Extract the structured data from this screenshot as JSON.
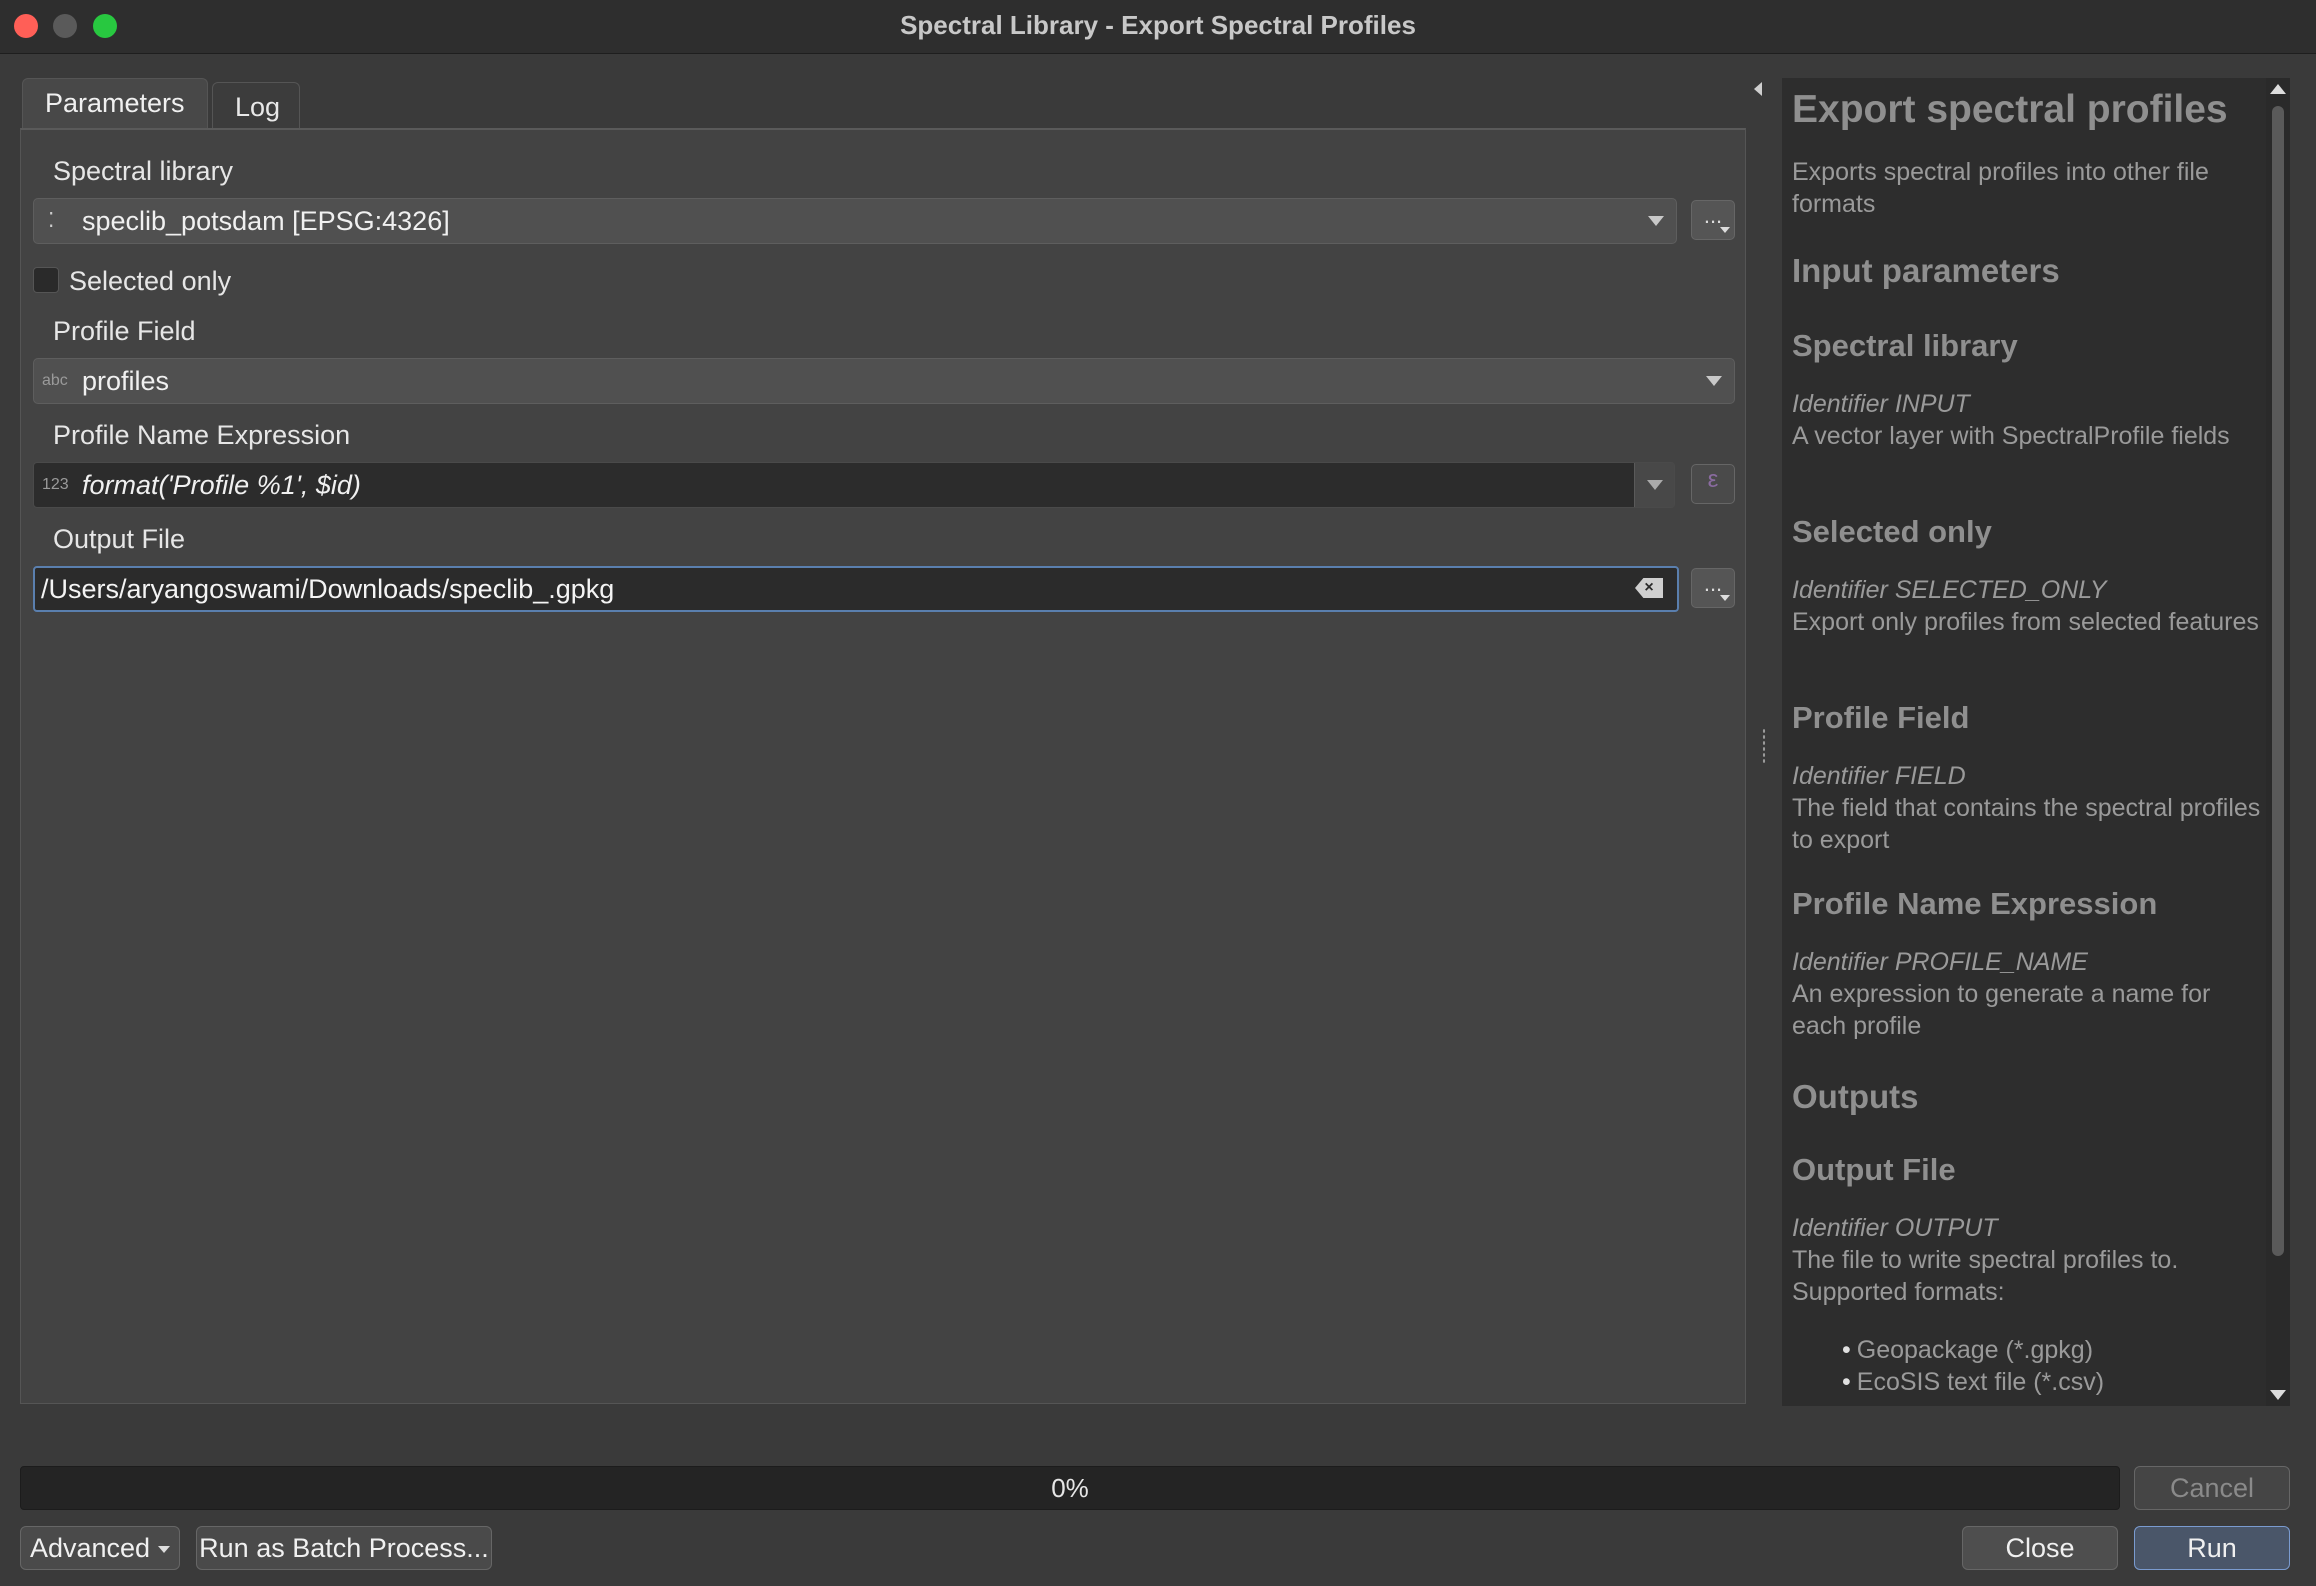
{
  "window": {
    "title": "Spectral Library - Export Spectral Profiles"
  },
  "tabs": [
    {
      "label": "Parameters",
      "active": true
    },
    {
      "label": "Log",
      "active": false
    }
  ],
  "form": {
    "spectral_library": {
      "label": "Spectral library",
      "value": "speclib_potsdam [EPSG:4326]",
      "browse": "..."
    },
    "selected_only": {
      "label": "Selected only",
      "checked": false
    },
    "profile_field": {
      "label": "Profile Field",
      "type_tag": "abc",
      "value": "profiles"
    },
    "profile_name": {
      "label": "Profile Name Expression",
      "type_tag": "123",
      "value": "format('Profile %1', $id)"
    },
    "output_file": {
      "label": "Output File",
      "value": "/Users/aryangoswami/Downloads/speclib_.gpkg",
      "browse": "..."
    }
  },
  "help": {
    "title": "Export spectral profiles",
    "description": "Exports spectral profiles into other file formats",
    "input_header": "Input parameters",
    "params": [
      {
        "name": "Spectral library",
        "identifier": "Identifier INPUT",
        "desc": "A vector layer with SpectralProfile fields"
      },
      {
        "name": "Selected only",
        "identifier": "Identifier SELECTED_ONLY",
        "desc": "Export only profiles from selected features"
      },
      {
        "name": "Profile Field",
        "identifier": "Identifier FIELD",
        "desc": "The field that contains the spectral profiles to export"
      },
      {
        "name": "Profile Name Expression",
        "identifier": "Identifier PROFILE_NAME",
        "desc": "An expression to generate a name for each profile"
      }
    ],
    "outputs_header": "Outputs",
    "output": {
      "name": "Output File",
      "identifier": "Identifier OUTPUT",
      "desc": "The file to write spectral profiles to. Supported formats:"
    },
    "formats": [
      "Geopackage (*.gpkg)",
      "EcoSIS text file (*.csv)"
    ]
  },
  "progress": {
    "text": "0%",
    "value": 0
  },
  "buttons": {
    "cancel": "Cancel",
    "advanced": "Advanced",
    "batch": "Run as Batch Process...",
    "close": "Close",
    "run": "Run"
  },
  "colors": {
    "accent": "#5a7fae",
    "background": "#3a3a3a",
    "close": "#ff5f57",
    "maximize": "#28c840"
  }
}
